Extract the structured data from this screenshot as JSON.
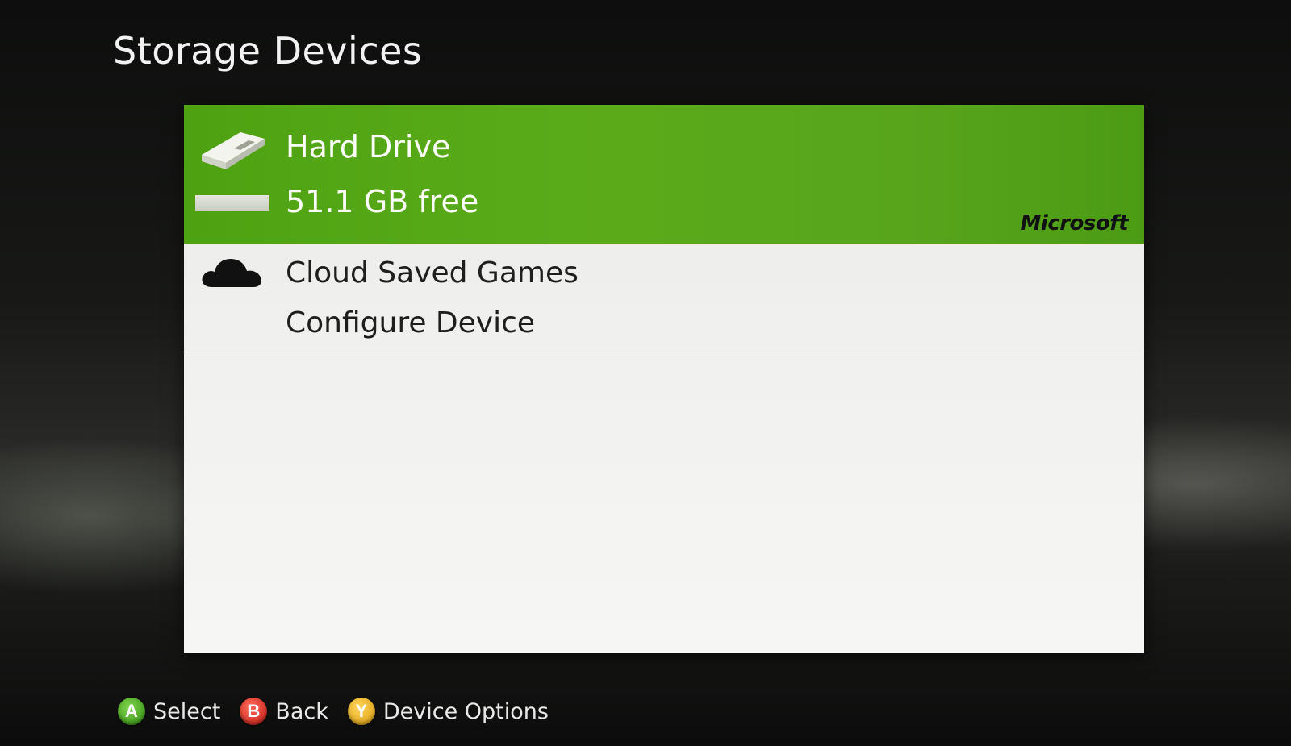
{
  "page": {
    "title": "Storage Devices"
  },
  "device": {
    "name": "Hard Drive",
    "free_text": "51.1 GB free",
    "brand": "Microsoft",
    "icon": "hard-drive-icon",
    "used_fraction": 1.0,
    "accent_color": "#57a818"
  },
  "options": {
    "cloud_label": "Cloud Saved Games",
    "cloud_icon": "cloud-icon",
    "configure_label": "Configure Device"
  },
  "footer": {
    "hints": [
      {
        "button": "A",
        "label": "Select",
        "color": "#45b01c"
      },
      {
        "button": "B",
        "label": "Back",
        "color": "#e2281c"
      },
      {
        "button": "Y",
        "label": "Device Options",
        "color": "#f0b014"
      }
    ]
  }
}
